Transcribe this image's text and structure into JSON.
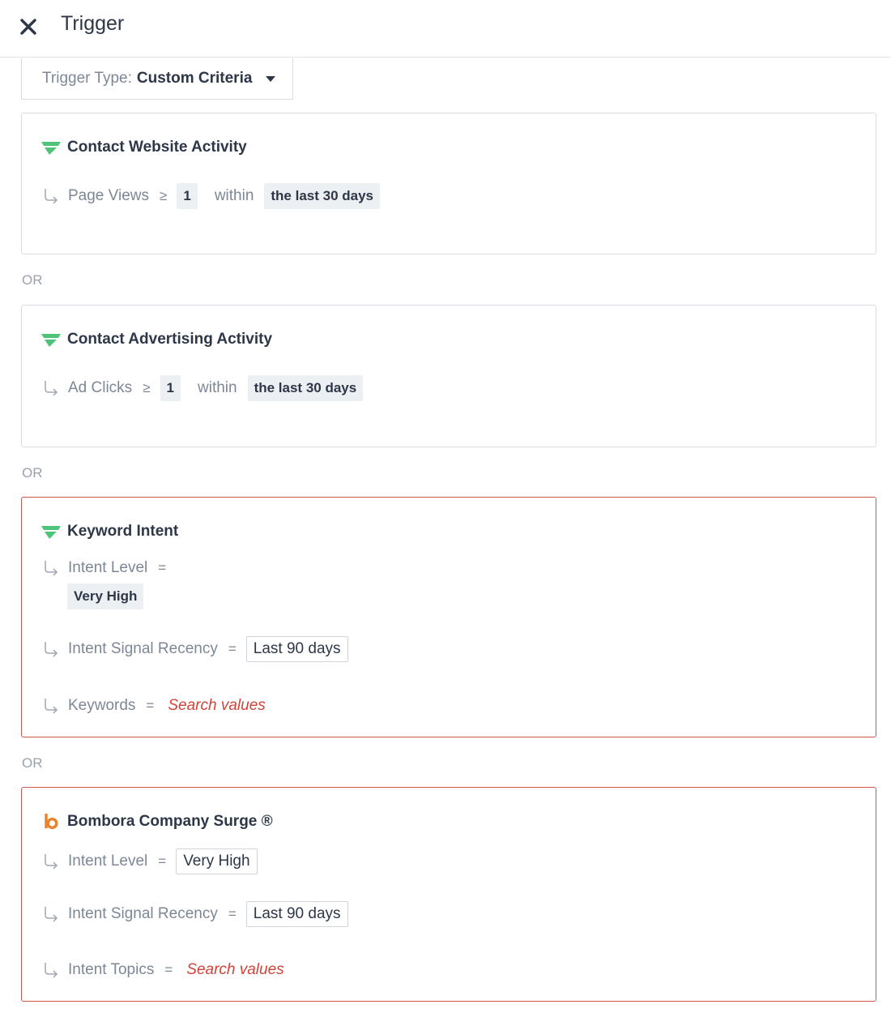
{
  "header": {
    "title": "Trigger",
    "close_icon": "close-icon"
  },
  "trigger_type": {
    "label": "Trigger Type:",
    "value": "Custom Criteria"
  },
  "or_label": "OR",
  "colors": {
    "accent_green": "#4fc478",
    "bombora_orange": "#e8832a",
    "error_red": "#d4564f",
    "search_red": "#d0433a"
  },
  "cards": [
    {
      "title": "Contact Website Activity",
      "icon": "brand-logo-icon",
      "rows": [
        {
          "label": "Page Views",
          "operator": "≥",
          "value": "1",
          "within": "within",
          "period": "the last 30 days"
        }
      ]
    },
    {
      "title": "Contact Advertising Activity",
      "icon": "brand-logo-icon",
      "rows": [
        {
          "label": "Ad Clicks",
          "operator": "≥",
          "value": "1",
          "within": "within",
          "period": "the last 30 days"
        }
      ]
    },
    {
      "title": "Keyword Intent",
      "icon": "brand-logo-icon",
      "rows": [
        {
          "label": "Intent Level",
          "operator": "=",
          "value": "Very High"
        },
        {
          "label": "Intent Signal Recency",
          "operator": "=",
          "value": "Last 90 days"
        },
        {
          "label": "Keywords",
          "operator": "=",
          "placeholder": "Search values"
        }
      ]
    },
    {
      "title": "Bombora Company Surge ®",
      "icon": "bombora-logo-icon",
      "rows": [
        {
          "label": "Intent Level",
          "operator": "=",
          "value": "Very High"
        },
        {
          "label": "Intent Signal Recency",
          "operator": "=",
          "value": "Last 90 days"
        },
        {
          "label": "Intent Topics",
          "operator": "=",
          "placeholder": "Search values"
        }
      ]
    }
  ]
}
